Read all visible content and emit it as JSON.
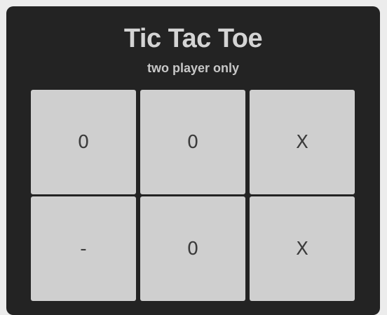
{
  "header": {
    "title": "Tic Tac Toe",
    "subtitle": "two player only"
  },
  "board": {
    "cells": [
      "0",
      "0",
      "X",
      "-",
      "0",
      "X"
    ]
  },
  "colors": {
    "panel": "#232323",
    "cell": "#cfcfcf",
    "title": "#d4d4d4"
  }
}
